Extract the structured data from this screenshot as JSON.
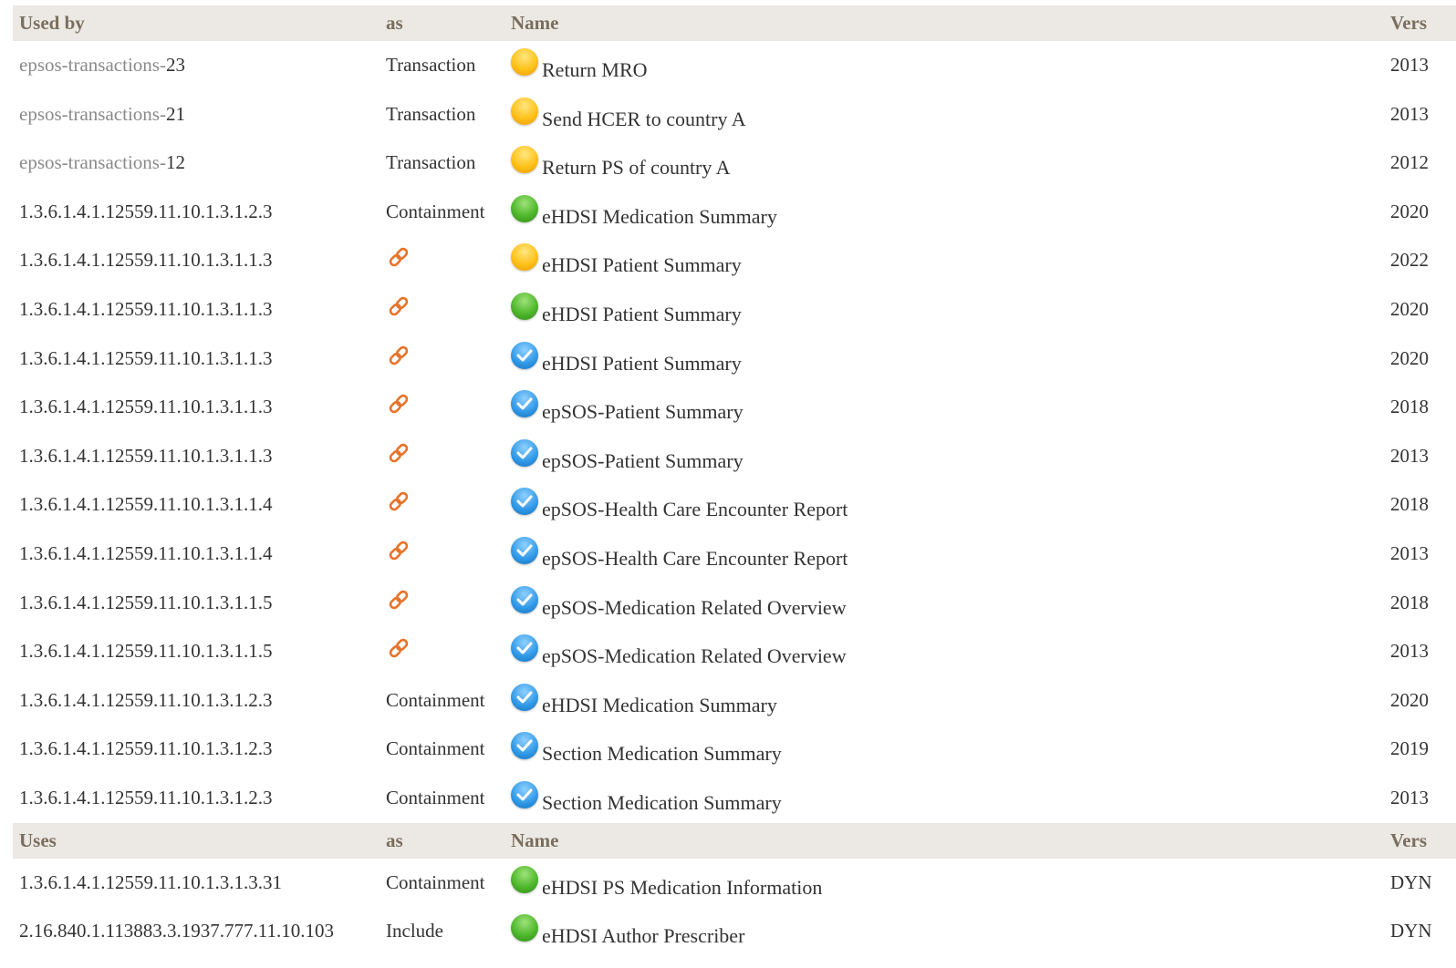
{
  "used_by_header": {
    "col1": "Used by",
    "col2": "as",
    "col3": "Name",
    "col4": "Vers"
  },
  "used_by_rows": [
    {
      "id_prefix": "epsos-transactions-",
      "id_suffix": "23",
      "as": "Transaction",
      "status": "pending",
      "name": "Return MRO",
      "version": "2013"
    },
    {
      "id_prefix": "epsos-transactions-",
      "id_suffix": "21",
      "as": "Transaction",
      "status": "pending",
      "name": "Send HCER to country A",
      "version": "2013"
    },
    {
      "id_prefix": "epsos-transactions-",
      "id_suffix": "12",
      "as": "Transaction",
      "status": "pending",
      "name": "Return PS of country A",
      "version": "2012"
    },
    {
      "id": "1.3.6.1.4.1.12559.11.10.1.3.1.2.3",
      "as": "Containment",
      "status": "active",
      "name": "eHDSI Medication Summary",
      "version": "2020"
    },
    {
      "id": "1.3.6.1.4.1.12559.11.10.1.3.1.1.3",
      "as_icon": "link-icon",
      "status": "pending",
      "name": "eHDSI Patient Summary",
      "version": "2022"
    },
    {
      "id": "1.3.6.1.4.1.12559.11.10.1.3.1.1.3",
      "as_icon": "link-icon",
      "status": "active",
      "name": "eHDSI Patient Summary",
      "version": "2020"
    },
    {
      "id": "1.3.6.1.4.1.12559.11.10.1.3.1.1.3",
      "as_icon": "link-icon",
      "status": "final",
      "name": "eHDSI Patient Summary",
      "version": "2020"
    },
    {
      "id": "1.3.6.1.4.1.12559.11.10.1.3.1.1.3",
      "as_icon": "link-icon",
      "status": "final",
      "name": "epSOS-Patient Summary",
      "version": "2018"
    },
    {
      "id": "1.3.6.1.4.1.12559.11.10.1.3.1.1.3",
      "as_icon": "link-icon",
      "status": "final",
      "name": "epSOS-Patient Summary",
      "version": "2013"
    },
    {
      "id": "1.3.6.1.4.1.12559.11.10.1.3.1.1.4",
      "as_icon": "link-icon",
      "status": "final",
      "name": "epSOS-Health Care Encounter Report",
      "version": "2018"
    },
    {
      "id": "1.3.6.1.4.1.12559.11.10.1.3.1.1.4",
      "as_icon": "link-icon",
      "status": "final",
      "name": "epSOS-Health Care Encounter Report",
      "version": "2013"
    },
    {
      "id": "1.3.6.1.4.1.12559.11.10.1.3.1.1.5",
      "as_icon": "link-icon",
      "status": "final",
      "name": "epSOS-Medication Related Overview",
      "version": "2018"
    },
    {
      "id": "1.3.6.1.4.1.12559.11.10.1.3.1.1.5",
      "as_icon": "link-icon",
      "status": "final",
      "name": "epSOS-Medication Related Overview",
      "version": "2013"
    },
    {
      "id": "1.3.6.1.4.1.12559.11.10.1.3.1.2.3",
      "as": "Containment",
      "status": "final",
      "name": "eHDSI Medication Summary",
      "version": "2020"
    },
    {
      "id": "1.3.6.1.4.1.12559.11.10.1.3.1.2.3",
      "as": "Containment",
      "status": "final",
      "name": "Section Medication Summary",
      "version": "2019"
    },
    {
      "id": "1.3.6.1.4.1.12559.11.10.1.3.1.2.3",
      "as": "Containment",
      "status": "final",
      "name": "Section Medication Summary",
      "version": "2013"
    }
  ],
  "uses_header": {
    "col1": "Uses",
    "col2": "as",
    "col3": "Name",
    "col4": "Vers"
  },
  "uses_rows": [
    {
      "id": "1.3.6.1.4.1.12559.11.10.1.3.1.3.31",
      "as": "Containment",
      "status": "active",
      "name": "eHDSI PS Medication Information",
      "version": "DYN"
    },
    {
      "id": "2.16.840.1.113883.3.1937.777.11.10.103",
      "as": "Include",
      "status": "active",
      "name": "eHDSI Author Prescriber",
      "version": "DYN"
    }
  ],
  "colors": {
    "header_bg": "#ece9e4",
    "header_text": "#7a6e5e",
    "link_icon": "#e8732a",
    "status_pending": "#ffc21a",
    "status_active": "#4fb82c",
    "status_final": "#2e98e6"
  }
}
